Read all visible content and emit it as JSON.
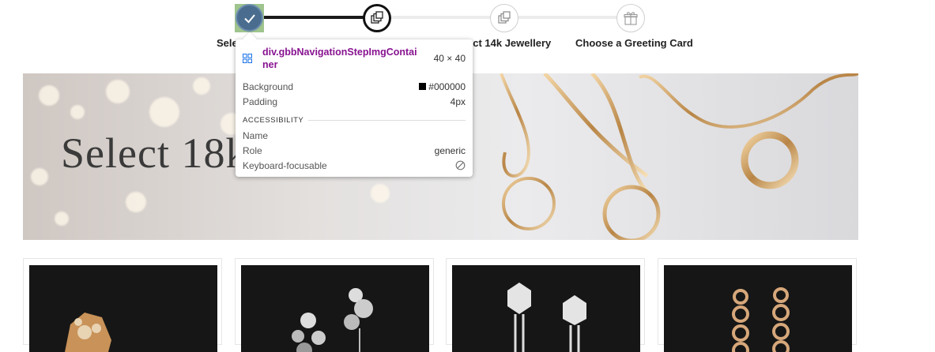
{
  "stepper": {
    "steps": [
      {
        "label": "Sele",
        "state": "complete",
        "icon": "checkmark-icon"
      },
      {
        "label": "",
        "state": "current",
        "icon": "stacked-squares-icon"
      },
      {
        "label": "ect 14k Jewellery",
        "state": "upcoming",
        "icon": "stacked-squares-icon"
      },
      {
        "label": "Choose a Greeting Card",
        "state": "upcoming",
        "icon": "gift-icon"
      }
    ]
  },
  "banner": {
    "title": "Select 18k Jewellery"
  },
  "products": [
    {
      "name": "rose-gold-flower-ring",
      "image_bg": "#161616"
    },
    {
      "name": "diamond-bubble-earrings",
      "image_bg": "#161616"
    },
    {
      "name": "diamond-rose-drop-earrings",
      "image_bg": "#161616"
    },
    {
      "name": "rose-gold-chain-earrings",
      "image_bg": "#161616"
    }
  ],
  "inspector": {
    "selector": "div.gbbNavigationStepImgContainer",
    "dimensions": "40 × 40",
    "properties": [
      {
        "key": "Background",
        "value": "#000000"
      },
      {
        "key": "Padding",
        "value": "4px"
      }
    ],
    "accessibility_heading": "ACCESSIBILITY",
    "accessibility": [
      {
        "key": "Name",
        "value": ""
      },
      {
        "key": "Role",
        "value": "generic"
      },
      {
        "key": "Keyboard-focusable",
        "value": ""
      }
    ]
  },
  "colors": {
    "selector": "#881391",
    "step_complete": "#4a6d8f",
    "highlight": "#9fc48d",
    "progress_done": "#1a1a1a",
    "progress_todo": "#ececec"
  }
}
